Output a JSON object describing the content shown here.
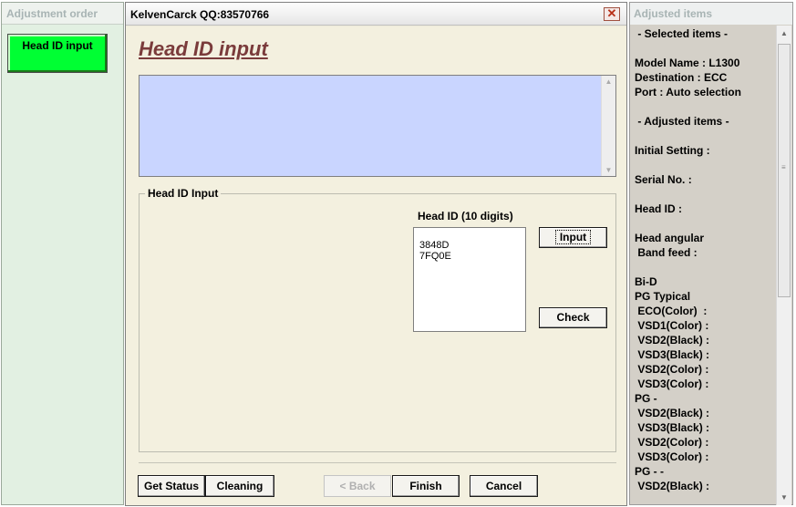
{
  "left_panel": {
    "title": "Adjustment order",
    "items": [
      {
        "label": "Head ID input"
      }
    ],
    "active_color": "#00ff33"
  },
  "dialog": {
    "title": "KelvenCarck QQ:83570766",
    "close_icon": "close-icon",
    "heading": "Head ID input",
    "info_area_text": "",
    "group_label": "Head ID Input",
    "head_id_label": "Head ID (10 digits)",
    "head_id_value": "3848D\n7FQ0E",
    "input_button": "Input",
    "check_button": "Check",
    "footer": {
      "get_status": "Get Status",
      "cleaning": "Cleaning",
      "back": "< Back",
      "finish": "Finish",
      "cancel": "Cancel"
    },
    "heading_color": "#7a3b3b",
    "info_area_color": "#c9d5ff"
  },
  "right_panel": {
    "title": "Adjusted items",
    "lines": [
      " - Selected items -",
      "",
      "Model Name : L1300",
      "Destination : ECC",
      "Port : Auto selection",
      "",
      " - Adjusted items -",
      "",
      "Initial Setting :",
      "",
      "Serial No. :",
      "",
      "Head ID :",
      "",
      "Head angular",
      " Band feed :",
      "",
      "Bi-D",
      "PG Typical",
      " ECO(Color)  :",
      " VSD1(Color) :",
      " VSD2(Black) :",
      " VSD3(Black) :",
      " VSD2(Color) :",
      " VSD3(Color) :",
      "PG -",
      " VSD2(Black) :",
      " VSD3(Black) :",
      " VSD2(Color) :",
      " VSD3(Color) :",
      "PG - -",
      " VSD2(Black) :"
    ]
  }
}
